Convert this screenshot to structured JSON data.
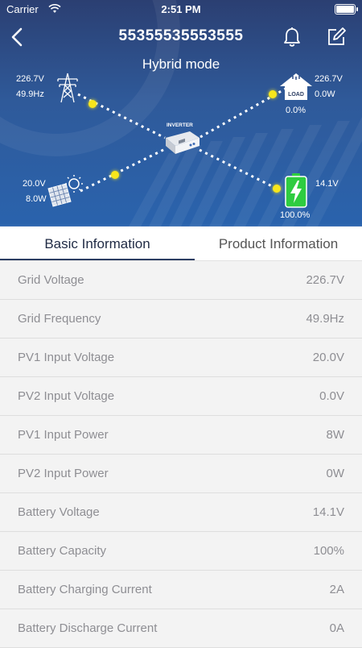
{
  "status_bar": {
    "carrier": "Carrier",
    "time": "2:51 PM"
  },
  "header": {
    "title": "55355535553555",
    "mode": "Hybrid mode"
  },
  "diagram": {
    "grid": {
      "voltage": "226.7V",
      "frequency": "49.9Hz"
    },
    "load": {
      "voltage": "226.7V",
      "power": "0.0W",
      "percent": "0.0%",
      "icon_label": "LOAD"
    },
    "inverter": {
      "label": "INVERTER"
    },
    "pv": {
      "voltage": "20.0V",
      "power": "8.0W"
    },
    "battery": {
      "voltage": "14.1V",
      "percent": "100.0%"
    },
    "accent_color": "#f7e61c",
    "battery_color": "#2ecc40"
  },
  "tabs": [
    {
      "label": "Basic Information",
      "active": true
    },
    {
      "label": "Product Information",
      "active": false
    }
  ],
  "rows": [
    {
      "label": "Grid Voltage",
      "value": "226.7V"
    },
    {
      "label": "Grid Frequency",
      "value": "49.9Hz"
    },
    {
      "label": "PV1 Input Voltage",
      "value": "20.0V"
    },
    {
      "label": "PV2 Input Voltage",
      "value": "0.0V"
    },
    {
      "label": "PV1 Input Power",
      "value": "8W"
    },
    {
      "label": "PV2 Input Power",
      "value": "0W"
    },
    {
      "label": "Battery Voltage",
      "value": "14.1V"
    },
    {
      "label": "Battery Capacity",
      "value": "100%"
    },
    {
      "label": "Battery Charging Current",
      "value": "2A"
    },
    {
      "label": "Battery Discharge Current",
      "value": "0A"
    }
  ]
}
